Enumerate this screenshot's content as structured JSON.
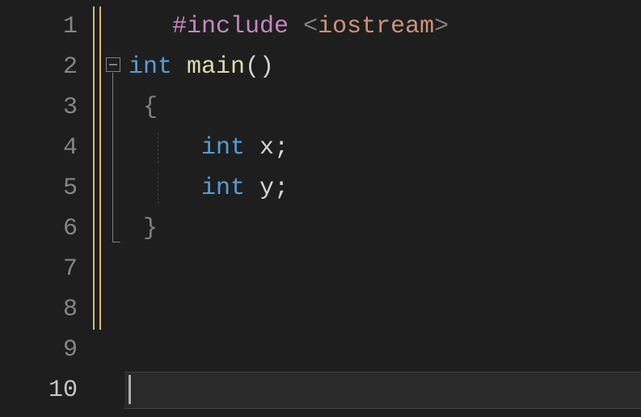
{
  "lines": [
    {
      "num": "1",
      "tokens": [
        {
          "cls": "",
          "t": "   "
        },
        {
          "cls": "tok-preproc",
          "t": "#include"
        },
        {
          "cls": "",
          "t": " "
        },
        {
          "cls": "tok-angle",
          "t": "<"
        },
        {
          "cls": "tok-string",
          "t": "iostream"
        },
        {
          "cls": "tok-angle",
          "t": ">"
        }
      ]
    },
    {
      "num": "2",
      "tokens": [
        {
          "cls": "tok-keyword",
          "t": "int"
        },
        {
          "cls": "",
          "t": " "
        },
        {
          "cls": "tok-func",
          "t": "main"
        },
        {
          "cls": "tok-punct",
          "t": "()"
        }
      ],
      "foldable": true
    },
    {
      "num": "3",
      "tokens": [
        {
          "cls": "tok-brace",
          "t": " {"
        }
      ]
    },
    {
      "num": "4",
      "tokens": [
        {
          "cls": "",
          "t": "     "
        },
        {
          "cls": "tok-keyword",
          "t": "int"
        },
        {
          "cls": "",
          "t": " "
        },
        {
          "cls": "tok-ident",
          "t": "x"
        },
        {
          "cls": "tok-punct",
          "t": ";"
        }
      ],
      "indent": true
    },
    {
      "num": "5",
      "tokens": [
        {
          "cls": "",
          "t": "     "
        },
        {
          "cls": "tok-keyword",
          "t": "int"
        },
        {
          "cls": "",
          "t": " "
        },
        {
          "cls": "tok-ident",
          "t": "y"
        },
        {
          "cls": "tok-punct",
          "t": ";"
        }
      ],
      "indent": true
    },
    {
      "num": "6",
      "tokens": [
        {
          "cls": "tok-brace",
          "t": " }"
        }
      ]
    },
    {
      "num": "7",
      "tokens": []
    },
    {
      "num": "8",
      "tokens": []
    },
    {
      "num": "9",
      "tokens": []
    },
    {
      "num": "10",
      "tokens": [],
      "current": true
    }
  ],
  "change_bar_color": "#d7ba7d"
}
